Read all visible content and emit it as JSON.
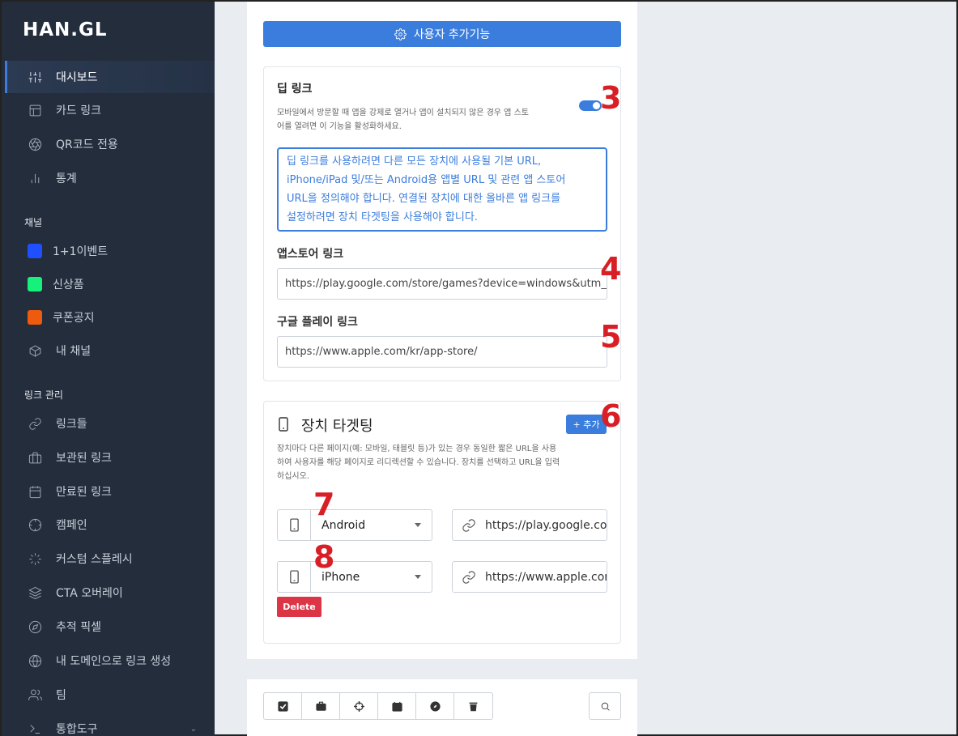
{
  "app": {
    "logo": "HAN.GL"
  },
  "sidebar": {
    "items": [
      {
        "label": "대시보드",
        "icon": "sliders-icon"
      },
      {
        "label": "카드 링크",
        "icon": "layout-icon"
      },
      {
        "label": "QR코드 전용",
        "icon": "aperture-icon"
      },
      {
        "label": "통계",
        "icon": "bar-chart-icon"
      }
    ],
    "channels_label": "채널",
    "channels": [
      {
        "label": "1+1이벤트",
        "color": "#1f4fff"
      },
      {
        "label": "신상품",
        "color": "#17f07a"
      },
      {
        "label": "쿠폰공지",
        "color": "#ee5a0e"
      },
      {
        "label": "내 채널",
        "icon": "box-icon"
      }
    ],
    "links_label": "링크 관리",
    "links": [
      {
        "label": "링크들",
        "icon": "link-icon"
      },
      {
        "label": "보관된 링크",
        "icon": "briefcase-icon"
      },
      {
        "label": "만료된 링크",
        "icon": "calendar-icon"
      },
      {
        "label": "캠페인",
        "icon": "crosshair-icon"
      },
      {
        "label": "커스텀 스플레시",
        "icon": "loader-icon"
      },
      {
        "label": "CTA 오버레이",
        "icon": "layers-icon"
      },
      {
        "label": "추적 픽셀",
        "icon": "compass-icon"
      },
      {
        "label": "내 도메인으로 링크 생성",
        "icon": "globe-icon"
      },
      {
        "label": "팀",
        "icon": "users-icon"
      },
      {
        "label": "통합도구",
        "icon": "terminal-icon"
      }
    ]
  },
  "main": {
    "top_button": "사용자 추가기능",
    "deeplink": {
      "title": "딥 링크",
      "description_line1": "모바일에서 방문할 때 앱을 강제로 열거나 앱이 설치되지 않은 경우 앱 스토",
      "description_line2": "어를 열려면 이 기능을 활성화하세요.",
      "toggle_on": true,
      "info_line1": "딥 링크를 사용하려면 다른 모든 장치에 사용될 기본 URL,",
      "info_line2": "iPhone/iPad 및/또는 Android용 앱별 URL 및 관련 앱 스토어",
      "info_line3": "URL을 정의해야 합니다. 연결된 장치에 대한 올바른 앱 링크를",
      "info_line4": "설정하려면 장치 타겟팅을 사용해야 합니다.",
      "appstore_label": "앱스토어 링크",
      "appstore_value": "https://play.google.com/store/games?device=windows&utm_",
      "googleplay_label": "구글 플레이 링크",
      "googleplay_value": "https://www.apple.com/kr/app-store/"
    },
    "device_targeting": {
      "title": "장치 타겟팅",
      "add_button": "+ 추가",
      "description_line1": "장치마다 다른 페이지(예: 모바일, 태블릿 등)가 있는 경우 동일한 짧은 URL을 사용",
      "description_line2": "하여 사용자를 해당 페이지로 리디렉션할 수 있습니다. 장치를 선택하고 URL을 입력",
      "description_line3": "하십시오.",
      "rows": [
        {
          "device": "Android",
          "url": "https://play.google.com/"
        },
        {
          "device": "iPhone",
          "url": "https://www.apple.com/"
        }
      ],
      "delete_button": "Delete"
    }
  },
  "annotations": [
    "3",
    "4",
    "5",
    "6",
    "7",
    "8"
  ],
  "colors": {
    "accent": "#3b7ddd",
    "danger": "#dc3545",
    "sidebar_bg": "#232d3c",
    "annotation": "#d91f26"
  }
}
